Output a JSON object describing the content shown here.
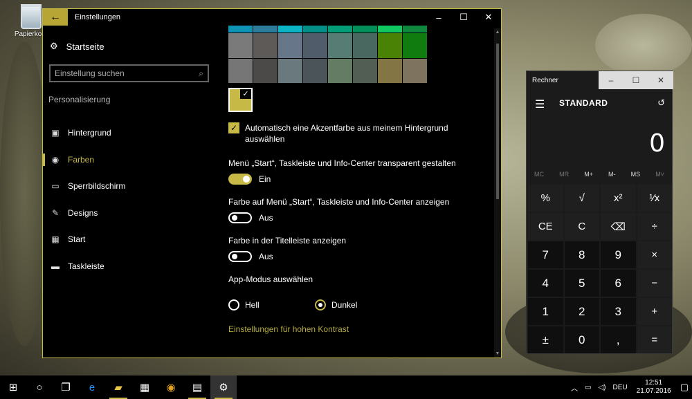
{
  "desktop": {
    "recycle_bin_label": "Papierkorb"
  },
  "settings": {
    "title": "Einstellungen",
    "back_symbol": "←",
    "controls": {
      "minimize": "–",
      "maximize": "☐",
      "close": "✕"
    },
    "home_label": "Startseite",
    "search_placeholder": "Einstellung suchen",
    "section_title": "Personalisierung",
    "nav": [
      {
        "label": "Hintergrund",
        "icon": "image-icon",
        "glyph": "▣"
      },
      {
        "label": "Farben",
        "icon": "palette-icon",
        "glyph": "◉",
        "active": true
      },
      {
        "label": "Sperrbildschirm",
        "icon": "lockscreen-icon",
        "glyph": "▭"
      },
      {
        "label": "Designs",
        "icon": "brush-icon",
        "glyph": "✎"
      },
      {
        "label": "Start",
        "icon": "start-icon",
        "glyph": "▦"
      },
      {
        "label": "Taskleiste",
        "icon": "taskbar-icon",
        "glyph": "▬"
      }
    ],
    "swatch_rows": [
      [
        "#0e93b5",
        "#2d7d9a",
        "#0bb5c5",
        "#008f87",
        "#009b77",
        "#008e5a",
        "#11c760",
        "#0f893e"
      ],
      [
        "#7a7a7a",
        "#5d5a58",
        "#68768a",
        "#515c6b",
        "#567c73",
        "#486860",
        "#498205",
        "#107c10"
      ],
      [
        "#767676",
        "#4c4a48",
        "#69797e",
        "#4a5459",
        "#647c64",
        "#525e54",
        "#847545",
        "#7e735f"
      ]
    ],
    "selected_accent": "#c6b946",
    "auto_accent_label": "Automatisch eine Akzentfarbe aus meinem Hintergrund auswählen",
    "transparency": {
      "label": "Menü „Start“, Taskleiste und Info-Center transparent gestalten",
      "state": "Ein",
      "on": true
    },
    "color_start": {
      "label": "Farbe auf Menü „Start“, Taskleiste und Info-Center anzeigen",
      "state": "Aus",
      "on": false
    },
    "color_titlebar": {
      "label": "Farbe in der Titelleiste anzeigen",
      "state": "Aus",
      "on": false
    },
    "app_mode": {
      "label": "App-Modus auswählen",
      "options": [
        "Hell",
        "Dunkel"
      ],
      "selected": "Dunkel"
    },
    "high_contrast_link": "Einstellungen für hohen Kontrast"
  },
  "calculator": {
    "title": "Rechner",
    "mode": "STANDARD",
    "display": "0",
    "memory": [
      {
        "label": "MC",
        "enabled": false
      },
      {
        "label": "MR",
        "enabled": false
      },
      {
        "label": "M+",
        "enabled": true
      },
      {
        "label": "M-",
        "enabled": true
      },
      {
        "label": "MS",
        "enabled": true
      },
      {
        "label": "M˅",
        "enabled": false
      }
    ],
    "keys": [
      {
        "label": "%",
        "type": "fn",
        "name": "percent"
      },
      {
        "label": "√",
        "type": "fn",
        "name": "sqrt"
      },
      {
        "label": "x²",
        "type": "fn",
        "name": "square"
      },
      {
        "label": "¹⁄x",
        "type": "fn",
        "name": "reciprocal"
      },
      {
        "label": "CE",
        "type": "fn",
        "name": "clear-entry"
      },
      {
        "label": "C",
        "type": "fn",
        "name": "clear"
      },
      {
        "label": "⌫",
        "type": "fn",
        "name": "backspace"
      },
      {
        "label": "÷",
        "type": "fn",
        "name": "divide"
      },
      {
        "label": "7",
        "type": "num",
        "name": "7"
      },
      {
        "label": "8",
        "type": "num",
        "name": "8"
      },
      {
        "label": "9",
        "type": "num",
        "name": "9"
      },
      {
        "label": "×",
        "type": "fn",
        "name": "multiply"
      },
      {
        "label": "4",
        "type": "num",
        "name": "4"
      },
      {
        "label": "5",
        "type": "num",
        "name": "5"
      },
      {
        "label": "6",
        "type": "num",
        "name": "6"
      },
      {
        "label": "−",
        "type": "fn",
        "name": "minus"
      },
      {
        "label": "1",
        "type": "num",
        "name": "1"
      },
      {
        "label": "2",
        "type": "num",
        "name": "2"
      },
      {
        "label": "3",
        "type": "num",
        "name": "3"
      },
      {
        "label": "+",
        "type": "fn",
        "name": "plus"
      },
      {
        "label": "±",
        "type": "num",
        "name": "negate"
      },
      {
        "label": "0",
        "type": "num",
        "name": "0"
      },
      {
        "label": ",",
        "type": "num",
        "name": "decimal"
      },
      {
        "label": "=",
        "type": "fn",
        "name": "equals"
      }
    ]
  },
  "taskbar": {
    "apps": [
      {
        "name": "windows-start-icon",
        "glyph": "⊞"
      },
      {
        "name": "cortana-icon",
        "glyph": "○"
      },
      {
        "name": "task-view-icon",
        "glyph": "❐"
      },
      {
        "name": "edge-icon",
        "glyph": "e",
        "color": "#1e90ff"
      },
      {
        "name": "explorer-icon",
        "glyph": "▰",
        "color": "#e8c44a",
        "running": true
      },
      {
        "name": "store-icon",
        "glyph": "▦"
      },
      {
        "name": "chrome-icon",
        "glyph": "◉",
        "color": "#e0a020"
      },
      {
        "name": "calculator-icon",
        "glyph": "▤",
        "running": true
      },
      {
        "name": "settings-icon",
        "glyph": "⚙",
        "running": true,
        "active": true
      }
    ],
    "tray": {
      "language": "DEU",
      "time": "12:51",
      "date": "21.07.2016"
    }
  }
}
